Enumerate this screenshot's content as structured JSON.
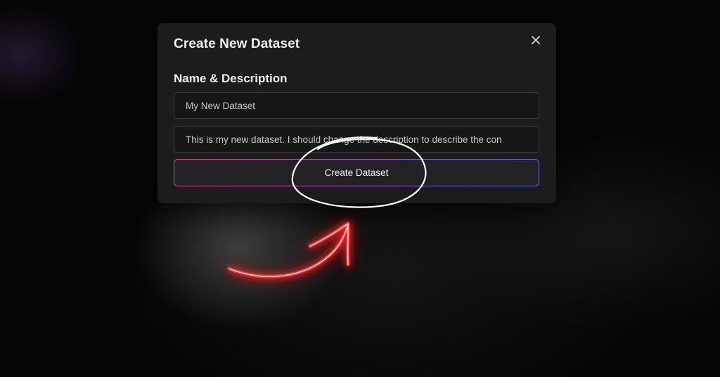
{
  "modal": {
    "title": "Create New Dataset",
    "section_label": "Name & Description",
    "name_value": "My New Dataset",
    "description_value": "This is my new dataset. I should change the description to describe the con",
    "create_button_label": "Create Dataset",
    "close_icon": "close-icon"
  },
  "annotation": {
    "circle_color": "#ffffff",
    "arrow_color": "#ff1a1a"
  }
}
